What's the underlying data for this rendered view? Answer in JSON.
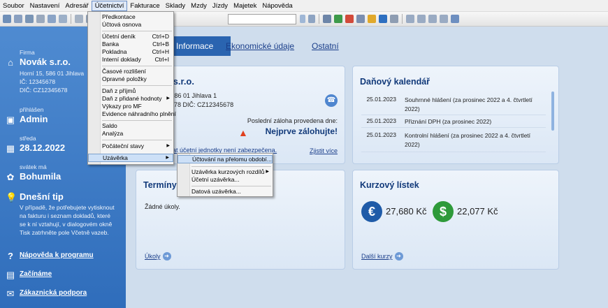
{
  "menubar": {
    "items": [
      "Soubor",
      "Nastavení",
      "Adresář",
      "Účetnictví",
      "Fakturace",
      "Sklady",
      "Mzdy",
      "Jízdy",
      "Majetek",
      "Nápověda"
    ]
  },
  "sidebar": {
    "firm_label": "Firma",
    "firm_name": "Novák s.r.o.",
    "firm_address": "Horní 15, 586 01 Jihlava",
    "firm_ic": "IČ: 12345678",
    "firm_dic": "DIČ: CZ12345678",
    "user_label": "přihlášen",
    "user_name": "Admin",
    "day_label": "středa",
    "date": "28.12.2022",
    "nameday_label": "svátek má",
    "nameday_name": "Bohumila",
    "tip_title": "Dnešní tip",
    "tip_lines": [
      "V případě, že potřebujete vytisknout",
      "na fakturu i seznam dokladů, které",
      "se k ní vztahují, v dialogovém okně",
      "Tisk zatrhněte pole Včetně vazeb."
    ],
    "help_link": "Nápověda k programu",
    "start_link": "Začínáme",
    "support_link": "Zákaznická podpora"
  },
  "tabs": {
    "active": "Informace",
    "economic": "Ekonomické údaje",
    "other": "Ostatní"
  },
  "info_panel": {
    "title": "Novák s.r.o.",
    "address": "Horní 15, 586 01 Jihlava 1",
    "ids": "IČ: 12345678  DIČ: CZ12345678",
    "backup_label": "Poslední záloha provedena dne:",
    "backup_warning": "Nejprve zálohujte!",
    "security_text": "Ochrana dat účetní jednotky není zabezpečena.",
    "more_link": "Zjistit více"
  },
  "tax_panel": {
    "title": "Daňový kalendář",
    "rows": [
      {
        "date": "25.01.2023",
        "text": "Souhrnné hlášení (za prosinec 2022 a 4. čtvrtletí 2022)"
      },
      {
        "date": "25.01.2023",
        "text": "Přiznání DPH (za prosinec 2022)"
      },
      {
        "date": "25.01.2023",
        "text": "Kontrolní hlášení (za prosinec 2022 a 4. čtvrtletí 2022)"
      }
    ]
  },
  "tasks_panel": {
    "title": "Termíny",
    "empty_text": "Žádné úkoly.",
    "link": "Úkoly"
  },
  "fx_panel": {
    "title": "Kurzový lístek",
    "eur_value": "27,680 Kč",
    "usd_value": "22,077 Kč",
    "link": "Další kurzy",
    "eur_symbol": "€",
    "usd_symbol": "$"
  },
  "accounting_menu": {
    "items": [
      {
        "label": "Předkontace",
        "shortcut": ""
      },
      {
        "label": "Účtová osnova",
        "shortcut": ""
      },
      {
        "label": "Účetní deník",
        "shortcut": "Ctrl+D"
      },
      {
        "label": "Banka",
        "shortcut": "Ctrl+B"
      },
      {
        "label": "Pokladna",
        "shortcut": "Ctrl+H"
      },
      {
        "label": "Interní doklady",
        "shortcut": "Ctrl+I"
      },
      {
        "label": "Časové rozlišení",
        "shortcut": ""
      },
      {
        "label": "Opravné položky",
        "shortcut": ""
      },
      {
        "label": "Daň z příjmů",
        "shortcut": ""
      },
      {
        "label": "Daň z přidané hodnoty",
        "shortcut": ""
      },
      {
        "label": "Výkazy pro MF",
        "shortcut": ""
      },
      {
        "label": "Evidence náhradního plnění",
        "shortcut": ""
      },
      {
        "label": "Saldo",
        "shortcut": ""
      },
      {
        "label": "Analýza",
        "shortcut": ""
      },
      {
        "label": "Počáteční stavy",
        "shortcut": ""
      },
      {
        "label": "Uzávěrka",
        "shortcut": ""
      }
    ]
  },
  "closing_submenu": {
    "items": [
      "Účtování na přelomu období...",
      "Uzávěrka kurzových rozdílů",
      "Účetní uzávěrka...",
      "Datová uzávěrka..."
    ]
  },
  "colors": {
    "sidebar": "#3a79c6",
    "tab_active": "#2a64b0",
    "warning": "#e0401e",
    "eur_coin": "#1f5ba8",
    "usd_coin": "#2e9a3a"
  }
}
